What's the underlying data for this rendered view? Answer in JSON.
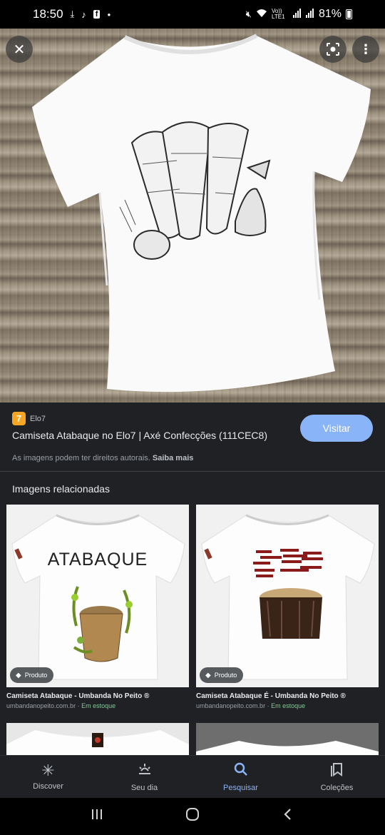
{
  "status_bar": {
    "time": "18:50",
    "left_icons": [
      "download-icon",
      "tiktok-icon",
      "facebook-icon",
      "dot-icon"
    ],
    "right_icons": [
      "mute-icon",
      "wifi-icon",
      "volte-icon",
      "signal-icon",
      "signal-icon"
    ],
    "volte_label": "Vo)) LTE1",
    "battery": "81%"
  },
  "hero": {
    "close_icon": "close-icon",
    "lens_icon": "lens-icon",
    "more_icon": "more-vert-icon"
  },
  "result": {
    "source_favicon": "7",
    "source_name": "Elo7",
    "title": "Camiseta Atabaque no Elo7 | Axé Confecções (111CEC8)",
    "visit_label": "Visitar",
    "copyright_text": "As imagens podem ter direitos autorais.",
    "learn_more": "Saiba mais"
  },
  "related": {
    "heading": "Imagens relacionadas",
    "cards": [
      {
        "badge": "Produto",
        "shirt_text": "ATABAQUE",
        "title": "Camiseta Atabaque - Umbanda No Peito ®",
        "site": "umbandanopeito.com.br",
        "separator": " · ",
        "stock": "Em estoque"
      },
      {
        "badge": "Produto",
        "title": "Camiseta Atabaque É - Umbanda No Peito ®",
        "site": "umbandanopeito.com.br",
        "separator": " · ",
        "stock": "Em estoque"
      }
    ]
  },
  "bottom_nav": {
    "items": [
      {
        "label": "Discover",
        "icon": "asterisk-icon"
      },
      {
        "label": "Seu dia",
        "icon": "sunrise-icon"
      },
      {
        "label": "Pesquisar",
        "icon": "search-icon",
        "active": true
      },
      {
        "label": "Coleções",
        "icon": "bookmarks-icon"
      }
    ]
  },
  "colors": {
    "accent": "#8ab4f8",
    "background": "#202124",
    "stock_green": "#81c995",
    "favicon": "#f6a623"
  }
}
